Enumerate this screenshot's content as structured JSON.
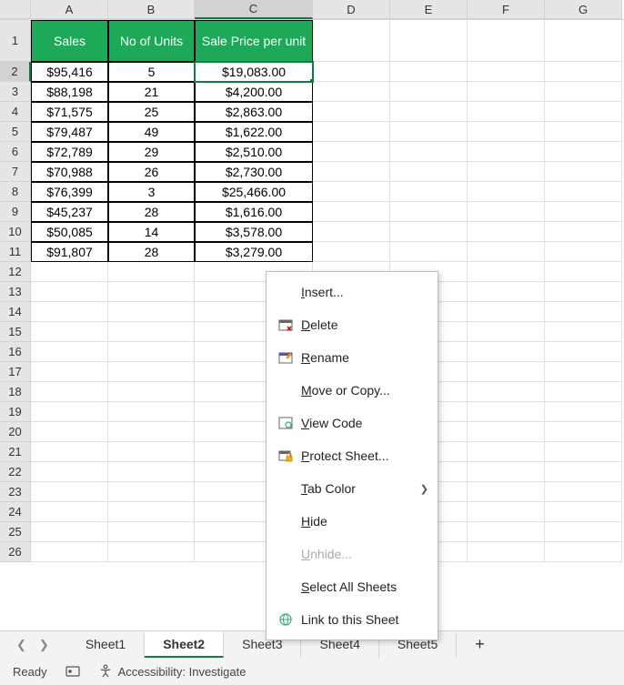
{
  "columns": [
    "A",
    "B",
    "C",
    "D",
    "E",
    "F",
    "G"
  ],
  "selected_cell": "C2",
  "headers": {
    "a": "Sales",
    "b": "No of Units",
    "c": "Sale Price per unit"
  },
  "rows": [
    {
      "a": "$95,416",
      "b": "5",
      "c": "$19,083.00"
    },
    {
      "a": "$88,198",
      "b": "21",
      "c": "$4,200.00"
    },
    {
      "a": "$71,575",
      "b": "25",
      "c": "$2,863.00"
    },
    {
      "a": "$79,487",
      "b": "49",
      "c": "$1,622.00"
    },
    {
      "a": "$72,789",
      "b": "29",
      "c": "$2,510.00"
    },
    {
      "a": "$70,988",
      "b": "26",
      "c": "$2,730.00"
    },
    {
      "a": "$76,399",
      "b": "3",
      "c": "$25,466.00"
    },
    {
      "a": "$45,237",
      "b": "28",
      "c": "$1,616.00"
    },
    {
      "a": "$50,085",
      "b": "14",
      "c": "$3,578.00"
    },
    {
      "a": "$91,807",
      "b": "28",
      "c": "$3,279.00"
    }
  ],
  "empty_rows": [
    12,
    13,
    14,
    15,
    16,
    17,
    18,
    19,
    20,
    21,
    22,
    23,
    24,
    25,
    26
  ],
  "sheet_tabs": [
    "Sheet1",
    "Sheet2",
    "Sheet3",
    "Sheet4",
    "Sheet5"
  ],
  "active_tab": "Sheet2",
  "status": {
    "ready": "Ready",
    "accessibility": "Accessibility: Investigate"
  },
  "context_menu": {
    "insert": "Insert...",
    "delete": "Delete",
    "rename": "Rename",
    "move": "Move or Copy...",
    "viewcode": "View Code",
    "protect": "Protect Sheet...",
    "tabcolor": "Tab Color",
    "hide": "Hide",
    "unhide": "Unhide...",
    "selectall": "Select All Sheets",
    "link": "Link to this Sheet"
  }
}
